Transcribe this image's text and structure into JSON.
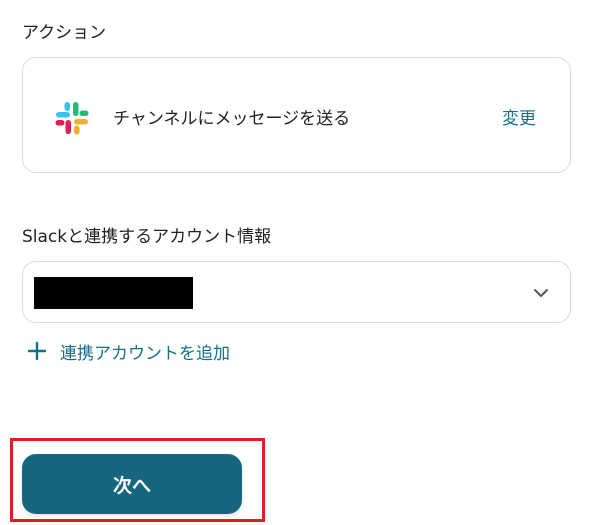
{
  "action_section": {
    "heading": "アクション",
    "app_icon": "slack-logo-icon",
    "action_name": "チャンネルにメッセージを送る",
    "change_label": "変更"
  },
  "account_section": {
    "heading": "Slackと連携するアカウント情報",
    "selected_value_redacted": true,
    "dropdown_icon": "chevron-down-icon",
    "add_account_icon": "plus-icon",
    "add_account_label": "連携アカウントを追加"
  },
  "footer": {
    "next_label": "次へ",
    "highlight_color": "#e01e22",
    "button_color": "#15677f"
  },
  "colors": {
    "link": "#15708a",
    "border": "#d9dcdf"
  }
}
